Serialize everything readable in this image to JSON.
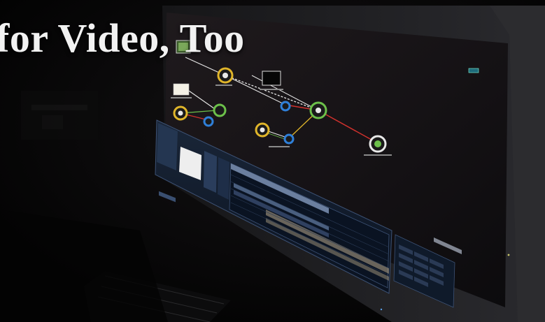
{
  "headline": "for Video, Too",
  "colors": {
    "background": "#050505",
    "monitor_bezel": "#1c1c1f",
    "screen": "#171316",
    "ui_panel": "#0f1a2a",
    "ui_panel_light": "#2a3a55",
    "connection_white": "#e8e8e8",
    "connection_red": "#d0312d",
    "connection_yellow": "#e0b52a",
    "connection_green": "#6cc04a",
    "connection_blue": "#2f7fd8"
  },
  "icons": [
    "image-node-icon",
    "process-node-icon",
    "keyboard-icon",
    "monitor-icon"
  ]
}
